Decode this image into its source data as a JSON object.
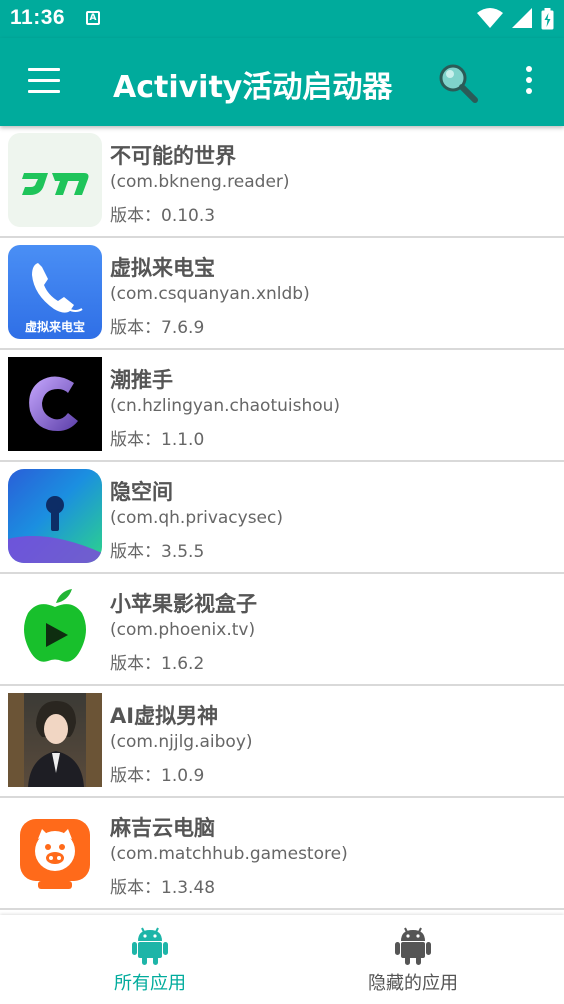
{
  "status_bar": {
    "time": "11:36",
    "notification_letter": "A"
  },
  "app_bar": {
    "title": "Activity活动启动器"
  },
  "apps": [
    {
      "name": "不可能的世界",
      "package": "(com.bkneng.reader)",
      "version": "版本：0.10.3",
      "icon": "bkneng-logo-icon"
    },
    {
      "name": "虚拟来电宝",
      "package": "(com.csquanyan.xnldb)",
      "version": "版本：7.6.9",
      "icon": "phone-icon",
      "icon_caption": "虚拟来电宝"
    },
    {
      "name": "潮推手",
      "package": "(cn.hzlingyan.chaotuishou)",
      "version": "版本：1.1.0",
      "icon": "c-logo-icon"
    },
    {
      "name": "隐空间",
      "package": "(com.qh.privacysec)",
      "version": "版本：3.5.5",
      "icon": "keyhole-icon"
    },
    {
      "name": "小苹果影视盒子",
      "package": "(com.phoenix.tv)",
      "version": "版本：1.6.2",
      "icon": "apple-play-icon"
    },
    {
      "name": "AI虚拟男神",
      "package": "(com.njjlg.aiboy)",
      "version": "版本：1.0.9",
      "icon": "avatar-icon"
    },
    {
      "name": "麻吉云电脑",
      "package": "(com.matchhub.gamestore)",
      "version": "版本：1.3.48",
      "icon": "pig-tv-icon"
    }
  ],
  "bottom_nav": {
    "tabs": [
      {
        "label": "所有应用",
        "active": true,
        "icon": "android-icon"
      },
      {
        "label": "隐藏的应用",
        "active": false,
        "icon": "android-icon"
      }
    ]
  },
  "colors": {
    "primary": "#00ab9c",
    "active_icon": "#1db5a8",
    "inactive_icon": "#555555"
  }
}
